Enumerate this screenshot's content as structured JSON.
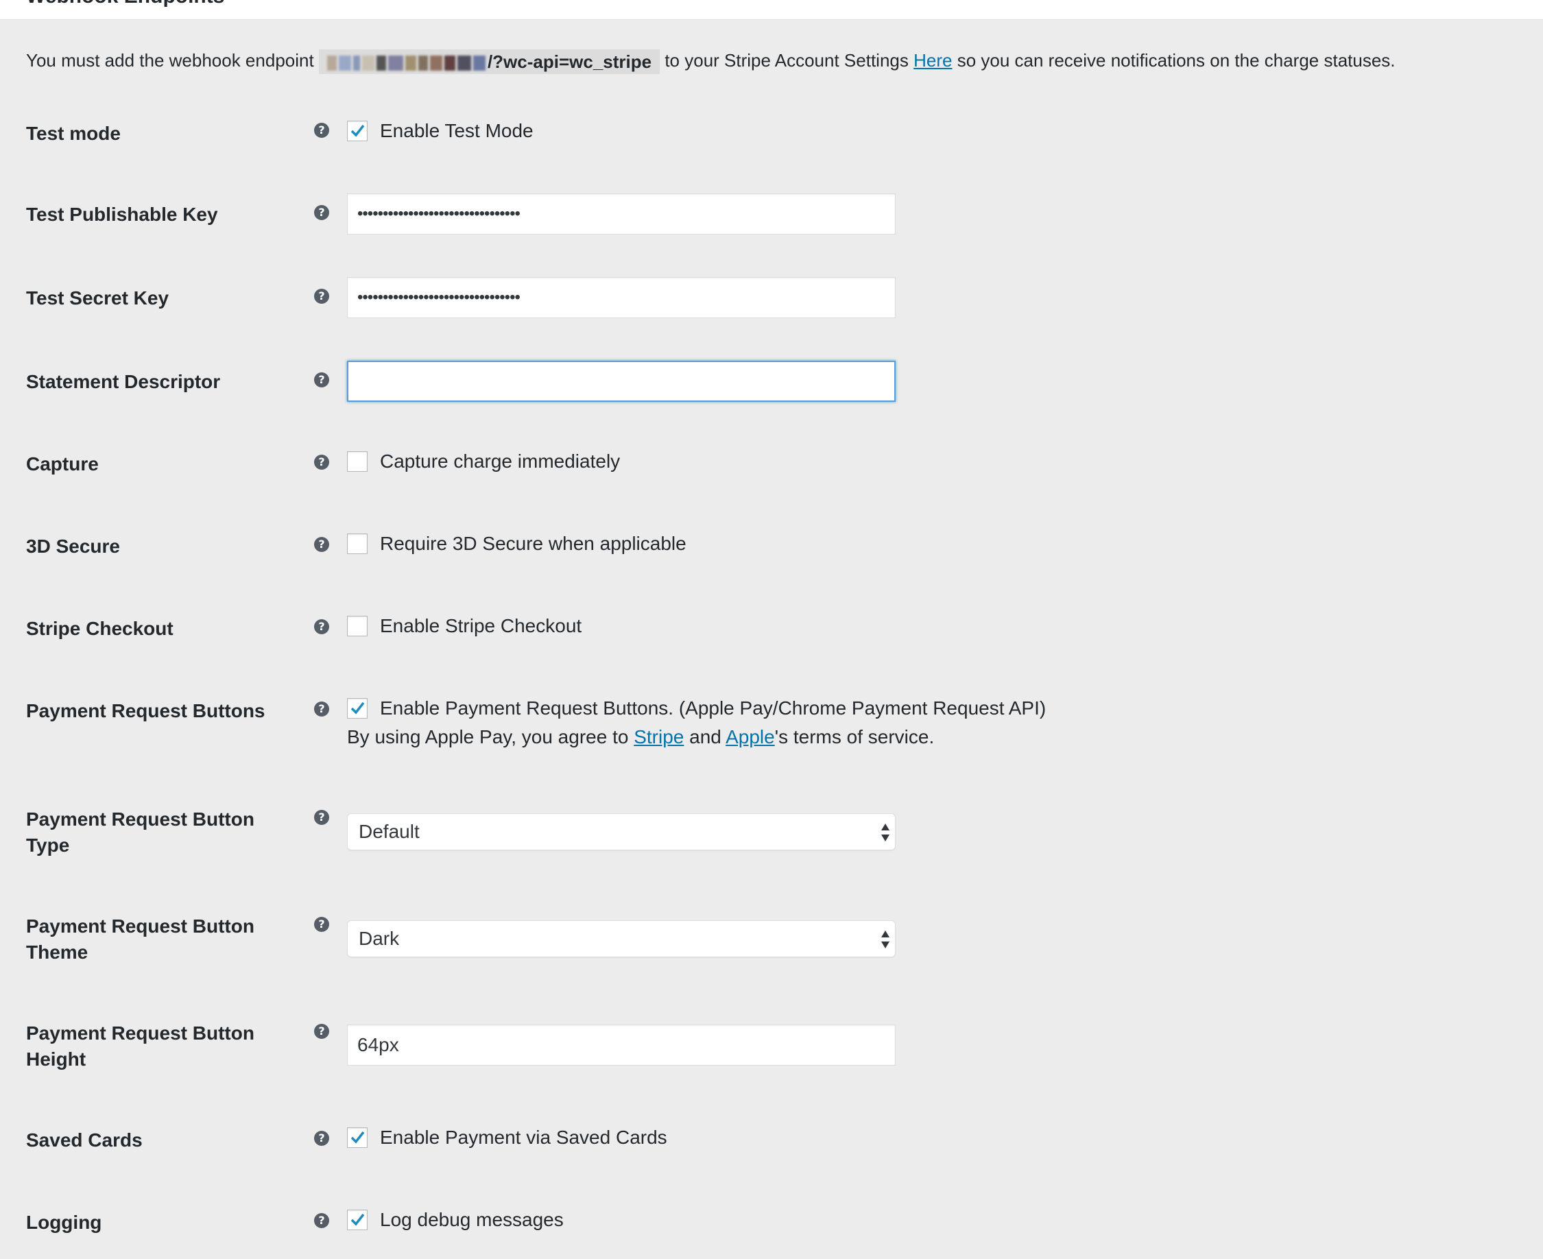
{
  "section_title": "Webhook Endpoints",
  "webhook": {
    "prefix": "You must add the webhook endpoint",
    "endpoint_visible": "/?wc-api=wc_stripe",
    "middle": "to your Stripe Account Settings",
    "link": "Here",
    "suffix": "so you can receive notifications on the charge statuses."
  },
  "help_glyph": "?",
  "fields": {
    "test_mode": {
      "label": "Test mode",
      "option": "Enable Test Mode",
      "checked": true
    },
    "test_publishable_key": {
      "label": "Test Publishable Key",
      "value": "••••••••••••••••••••••••••••••••"
    },
    "test_secret_key": {
      "label": "Test Secret Key",
      "value": "••••••••••••••••••••••••••••••••"
    },
    "statement_descriptor": {
      "label": "Statement Descriptor",
      "value": ""
    },
    "capture": {
      "label": "Capture",
      "option": "Capture charge immediately",
      "checked": false
    },
    "three_d_secure": {
      "label": "3D Secure",
      "option": "Require 3D Secure when applicable",
      "checked": false
    },
    "stripe_checkout": {
      "label": "Stripe Checkout",
      "option": "Enable Stripe Checkout",
      "checked": false
    },
    "payment_request": {
      "label": "Payment Request Buttons",
      "option": "Enable Payment Request Buttons. (Apple Pay/Chrome Payment Request API)",
      "checked": true,
      "desc_prefix": "By using Apple Pay, you agree to",
      "desc_link1": "Stripe",
      "desc_and": "and",
      "desc_link2": "Apple",
      "desc_suffix": "'s terms of service."
    },
    "button_type": {
      "label_line1": "Payment Request Button",
      "label_line2": "Type",
      "value": "Default"
    },
    "button_theme": {
      "label_line1": "Payment Request Button",
      "label_line2": "Theme",
      "value": "Dark"
    },
    "button_height": {
      "label_line1": "Payment Request Button",
      "label_line2": "Height",
      "value": "64px"
    },
    "saved_cards": {
      "label": "Saved Cards",
      "option": "Enable Payment via Saved Cards",
      "checked": true
    },
    "logging": {
      "label": "Logging",
      "option": "Log debug messages",
      "checked": true
    }
  },
  "colors": {
    "background": "#ececec",
    "link": "#0073aa",
    "focus_border": "#5b9dd9",
    "checkmark": "#1e8cbe"
  }
}
